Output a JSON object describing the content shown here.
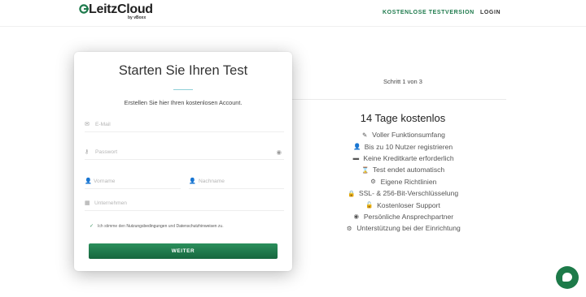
{
  "header": {
    "logo_text": "LeitzCloud",
    "logo_sub": "by vBoxx",
    "nav_trial": "KOSTENLOSE TESTVERSION",
    "nav_login": "LOGIN"
  },
  "form": {
    "title": "Starten Sie Ihren Test",
    "subtitle": "Erstellen Sie hier Ihren kostenlosen Account.",
    "email_placeholder": "E-Mail",
    "password_placeholder": "Passwort",
    "firstname_placeholder": "Vorname",
    "lastname_placeholder": "Nachname",
    "company_placeholder": "Unternehmen",
    "consent_prefix": "Ich stimme den",
    "consent_terms": "Nutzungsbedingungen",
    "consent_and": "und",
    "consent_privacy": "Datenschutzhinweisen",
    "consent_suffix": "zu.",
    "consent_checked": true,
    "submit_label": "WEITER"
  },
  "info": {
    "step": "Schritt 1 von 3",
    "features_title": "14 Tage kostenlos",
    "features": [
      {
        "icon": "pencil-icon",
        "glyph": "✎",
        "label": "Voller Funktionsumfang"
      },
      {
        "icon": "user-plus-icon",
        "glyph": "👤",
        "label": "Bis zu 10 Nutzer registrieren"
      },
      {
        "icon": "credit-card-icon",
        "glyph": "▬",
        "label": "Keine Kreditkarte erforderlich"
      },
      {
        "icon": "hourglass-icon",
        "glyph": "⌛",
        "label": "Test endet automatisch"
      },
      {
        "icon": "cogs-icon",
        "glyph": "⚙",
        "label": "Eigene Richtlinien"
      },
      {
        "icon": "lock-icon",
        "glyph": "🔒",
        "label": "SSL- & 256-Bit-Verschlüsselung"
      },
      {
        "icon": "lock-open-icon",
        "glyph": "🔓",
        "label": "Kostenloser Support"
      },
      {
        "icon": "user-circle-icon",
        "glyph": "◉",
        "label": "Persönliche Ansprechpartner"
      },
      {
        "icon": "cogs-icon",
        "glyph": "⚙",
        "label": "Unterstützung bei der Einrichtung"
      }
    ]
  },
  "colors": {
    "brand_green": "#1e7a4c",
    "button_green": "#16663e"
  }
}
